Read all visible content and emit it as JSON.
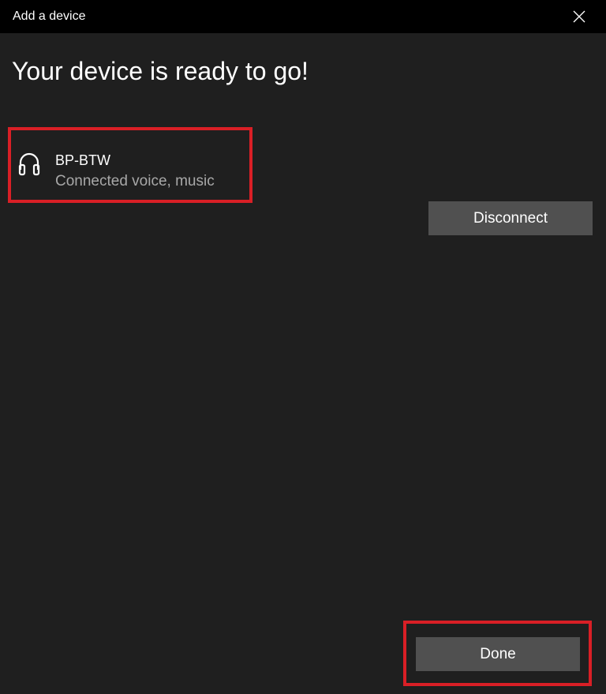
{
  "window": {
    "title": "Add a device",
    "close_icon": "close-icon"
  },
  "heading": "Your device is ready to go!",
  "device": {
    "icon": "headphones-icon",
    "name": "BP-BTW",
    "status": "Connected voice, music"
  },
  "buttons": {
    "disconnect_label": "Disconnect",
    "done_label": "Done"
  },
  "colors": {
    "window_background": "#1f1f1f",
    "titlebar_background": "#000000",
    "button_background": "#505050",
    "highlight_border": "#d91f26",
    "secondary_text": "#a8a8a8"
  }
}
